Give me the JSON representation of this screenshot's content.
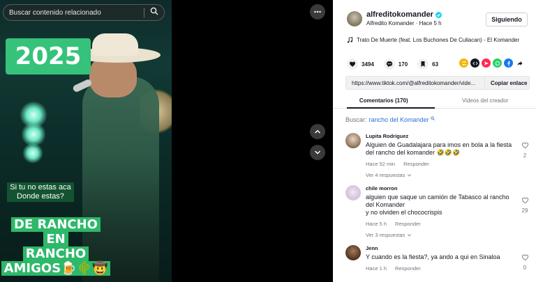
{
  "video": {
    "search_placeholder": "Buscar contenido relacionado",
    "badge_year": "2025",
    "caption_question": "Si tu no estas aca\nDonde estas?",
    "caption_lines": [
      "DE RANCHO",
      "EN",
      "RANCHO",
      "AMIGOS🍺🌵🤠"
    ]
  },
  "author": {
    "username": "alfreditokomander",
    "subtitle": "Alfredito Komander · Hace 5 h",
    "follow_label": "Siguiendo",
    "verified": true
  },
  "music": {
    "title": "Trato De Muerte (feat. Los Buchones De Culiacan) - El Komander"
  },
  "stats": {
    "likes": "3494",
    "comments": "170",
    "saves": "63"
  },
  "share_icons": [
    {
      "name": "repost-icon",
      "color": "#f4b400"
    },
    {
      "name": "embed-icon",
      "color": "#161823"
    },
    {
      "name": "send-icon",
      "color": "#fe2c55"
    },
    {
      "name": "whatsapp-icon",
      "color": "#25d366"
    },
    {
      "name": "facebook-icon",
      "color": "#1877f2"
    },
    {
      "name": "share-arrow-icon",
      "color": "#161823"
    }
  ],
  "link": {
    "url": "https://www.tiktok.com/@alfreditokomander/vide...",
    "copy_label": "Copiar enlace"
  },
  "tabs": [
    {
      "label": "Comentarios (170)",
      "active": true
    },
    {
      "label": "Videos del creador",
      "active": false
    }
  ],
  "comment_search": {
    "prefix": "Buscar:",
    "term": "rancho del Komander"
  },
  "comments": [
    {
      "author": "Lupita Rodriguez",
      "text": "Alguien de Guadalajara para imos en bola a la fiesta del rancho del komander 🤣🤣🤣",
      "time": "Hace 52 min",
      "reply": "Responder",
      "more": "Ver 4 respuestas",
      "likes": "2"
    },
    {
      "author": "chile morron",
      "text": "alguien que saque un camión de Tabasco al rancho del Komander\ny no olviden el chococrispis",
      "time": "Hace 5 h",
      "reply": "Responder",
      "more": "Ver 3 respuestas",
      "likes": "29"
    },
    {
      "author": "Jenn",
      "text": "Y cuando es la fiesta?, ya ando a qui en Sinaloa",
      "time": "Hace 1 h",
      "reply": "Responder",
      "more": "",
      "likes": "0"
    }
  ]
}
